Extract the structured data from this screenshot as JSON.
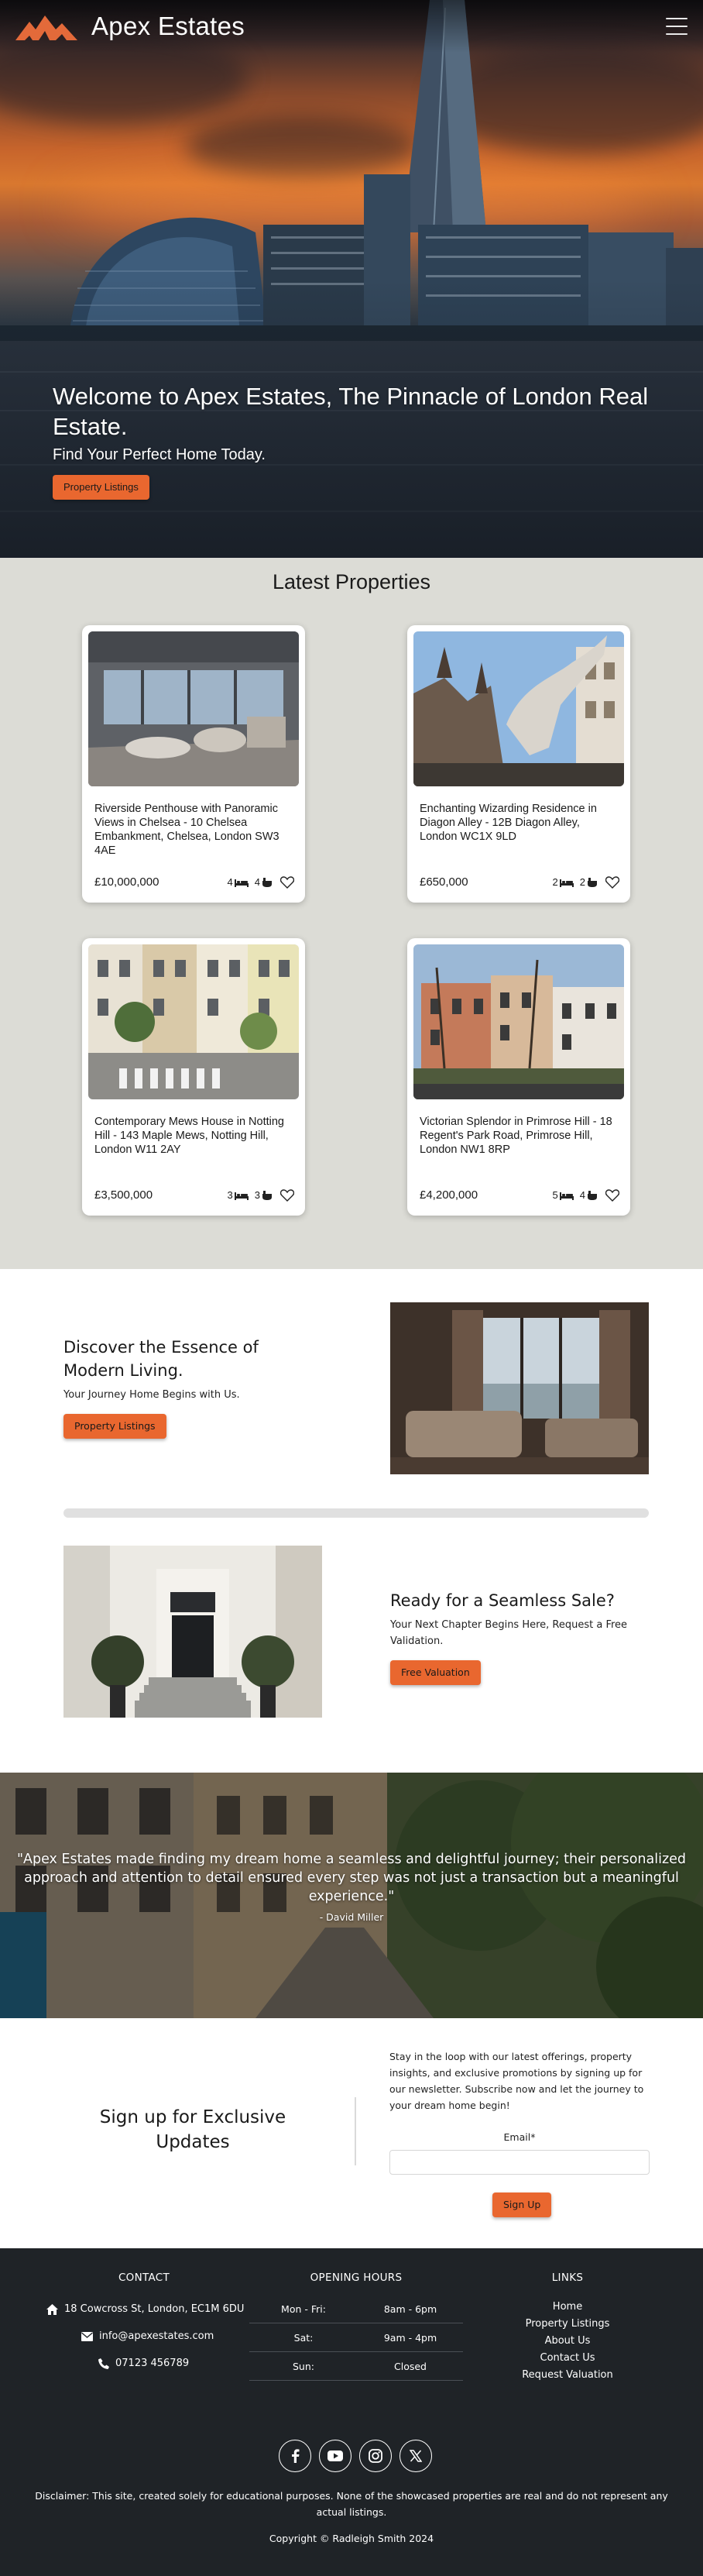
{
  "brand": {
    "name": "Apex Estates",
    "logo_icon": "mountain-logo-icon",
    "menu_icon": "hamburger-menu-icon"
  },
  "colors": {
    "accent": "#e9672f",
    "light_section": "#dcdcd6",
    "footer_bg": "#1f2327"
  },
  "hero": {
    "title": "Welcome to Apex Estates, The Pinnacle of London Real Estate.",
    "subtitle": "Find Your Perfect Home Today.",
    "button": "Property Listings"
  },
  "latest": {
    "title": "Latest Properties",
    "properties": [
      {
        "address": "Riverside Penthouse with Panoramic Views in Chelsea - 10 Chelsea Embankment, Chelsea, London SW3 4AE",
        "price": "£10,000,000",
        "beds": "4",
        "baths": "4"
      },
      {
        "address": "Enchanting Wizarding Residence in Diagon Alley - 12B Diagon Alley, London WC1X 9LD",
        "price": "£650,000",
        "beds": "2",
        "baths": "2"
      },
      {
        "address": "Contemporary Mews House in Notting Hill - 143 Maple Mews, Notting Hill, London W11 2AY",
        "price": "£3,500,000",
        "beds": "3",
        "baths": "3"
      },
      {
        "address": "Victorian Splendor in Primrose Hill - 18 Regent's Park Road, Primrose Hill, London NW1 8RP",
        "price": "£4,200,000",
        "beds": "5",
        "baths": "4"
      }
    ]
  },
  "discover": {
    "title": "Discover the Essence of Modern Living.",
    "subtitle": "Your Journey Home Begins with Us.",
    "button": "Property Listings"
  },
  "sale": {
    "title": "Ready for a Seamless Sale?",
    "subtitle": "Your Next Chapter Begins Here, Request a Free Validation.",
    "button": "Free Valuation"
  },
  "testimonial": {
    "quote": "\"Apex Estates made finding my dream home a seamless and delightful journey; their personalized approach and attention to detail ensured every step was not just a transaction but a meaningful experience.\"",
    "author": "- David Miller"
  },
  "signup": {
    "title": "Sign up for Exclusive Updates",
    "blurb": "Stay in the loop with our latest offerings, property insights, and exclusive promotions by signing up for our newsletter. Subscribe now and let the journey to your dream home begin!",
    "email_label": "Email*",
    "email_value": "",
    "button": "Sign Up"
  },
  "footer": {
    "contact_title": "CONTACT",
    "address": "18 Cowcross St, London, EC1M 6DU",
    "email": "info@apexestates.com",
    "phone": "07123 456789",
    "hours_title": "OPENING HOURS",
    "hours": [
      {
        "day": "Mon - Fri:",
        "time": "8am - 6pm"
      },
      {
        "day": "Sat:",
        "time": "9am - 4pm"
      },
      {
        "day": "Sun:",
        "time": "Closed"
      }
    ],
    "links_title": "LINKS",
    "links": [
      "Home",
      "Property Listings",
      "About Us",
      "Contact Us",
      "Request Valuation"
    ],
    "social_icons": [
      "facebook-icon",
      "youtube-icon",
      "instagram-icon",
      "x-twitter-icon"
    ],
    "disclaimer": "Disclaimer: This site, created solely for educational purposes. None of the showcased properties are real and do not represent any actual listings.",
    "copyright": "Copyright © Radleigh Smith 2024"
  }
}
